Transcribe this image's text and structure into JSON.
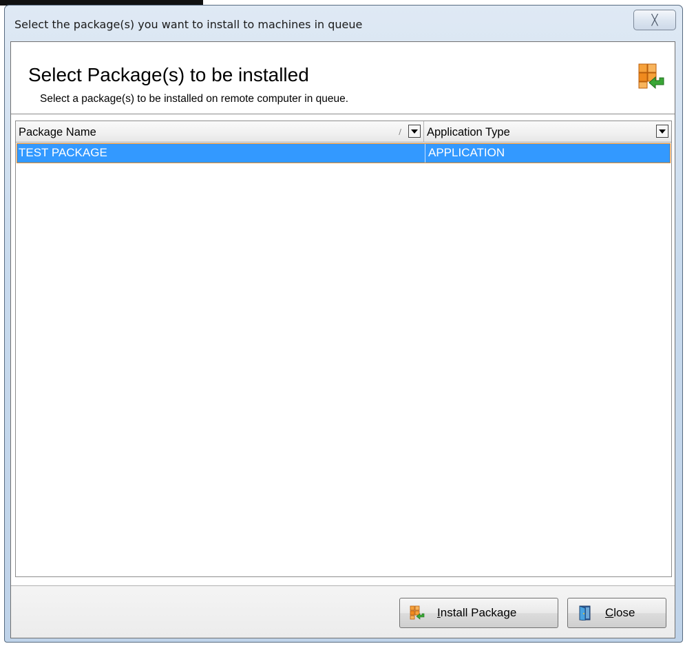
{
  "window": {
    "title": "Select the package(s) you want to install to machines in queue",
    "close_glyph": "╳"
  },
  "header": {
    "title": "Select Package(s) to be installed",
    "subtitle": "Select a package(s) to be installed on remote computer in queue.",
    "icon": "package-install-icon"
  },
  "grid": {
    "columns": [
      {
        "label": "Package Name",
        "sort": "ascending",
        "sort_glyph": "∕"
      },
      {
        "label": "Application Type"
      }
    ],
    "rows": [
      {
        "package_name": "TEST PACKAGE",
        "application_type": "APPLICATION",
        "selected": true
      }
    ]
  },
  "footer": {
    "install_button": {
      "mnemonic": "I",
      "rest": "nstall Package",
      "icon": "install-package-icon"
    },
    "close_button": {
      "mnemonic": "C",
      "rest": "lose",
      "icon": "exit-door-icon"
    }
  },
  "colors": {
    "selection": "#3399ff",
    "selection_border": "#e8871c",
    "icon_orange": "#f08a1e",
    "icon_green": "#3aa636"
  }
}
